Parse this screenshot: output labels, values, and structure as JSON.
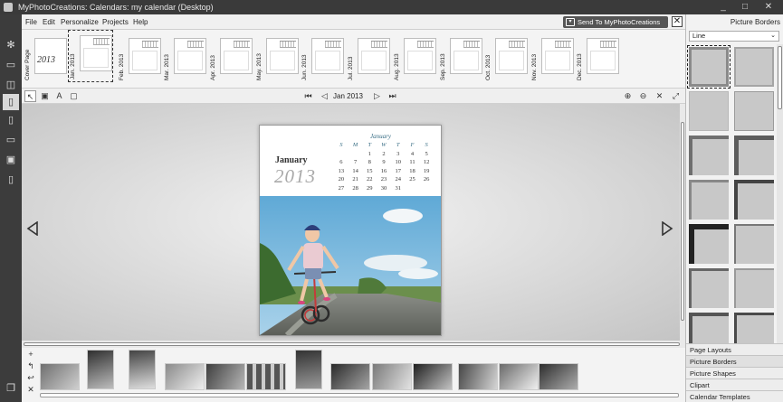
{
  "window": {
    "title": "MyPhotoCreations: Calendars: my calendar (Desktop)",
    "min": "_",
    "max": "□",
    "close": "✕"
  },
  "menu": {
    "items": [
      "File",
      "Edit",
      "Personalize",
      "Projects",
      "Help"
    ],
    "send_label": "Send To MyPhotoCreations",
    "close": "✕"
  },
  "left_tools": [
    "gear-icon",
    "book-icon",
    "layout-icon",
    "calendar-icon",
    "card-icon",
    "frame-icon",
    "album-icon",
    "page-icon"
  ],
  "pages": [
    {
      "label": "Cover Page",
      "cover": true,
      "year": "2013"
    },
    {
      "label": "Jan. 2013",
      "selected": true
    },
    {
      "label": "Feb. 2013"
    },
    {
      "label": "Mar. 2013"
    },
    {
      "label": "Apr. 2013"
    },
    {
      "label": "May. 2013"
    },
    {
      "label": "Jun. 2013"
    },
    {
      "label": "Jul. 2013"
    },
    {
      "label": "Aug. 2013"
    },
    {
      "label": "Sep. 2013"
    },
    {
      "label": "Oct. 2013"
    },
    {
      "label": "Nov. 2013"
    },
    {
      "label": "Dec. 2013"
    }
  ],
  "canvas_nav": {
    "first": "⏮",
    "prev": "◁",
    "label": "Jan 2013",
    "next": "▷",
    "last": "⏭"
  },
  "calendar": {
    "month": "January",
    "year": "2013",
    "grid_title": "January",
    "days_header": [
      "S",
      "M",
      "T",
      "W",
      "T",
      "F",
      "S"
    ],
    "weeks": [
      [
        "",
        "",
        "1",
        "2",
        "3",
        "4",
        "5"
      ],
      [
        "6",
        "7",
        "8",
        "9",
        "10",
        "11",
        "12"
      ],
      [
        "13",
        "14",
        "15",
        "16",
        "17",
        "18",
        "19"
      ],
      [
        "20",
        "21",
        "22",
        "23",
        "24",
        "25",
        "26"
      ],
      [
        "27",
        "28",
        "29",
        "30",
        "31",
        "",
        ""
      ]
    ]
  },
  "filmstrip_tools": [
    "+",
    "↰",
    "↩",
    "✕"
  ],
  "right_panel": {
    "title": "Picture Borders",
    "select_value": "Line",
    "caret": "⌄",
    "sections": [
      "Page Layouts",
      "Picture Borders",
      "Picture Shapes",
      "Clipart",
      "Calendar Templates"
    ]
  }
}
